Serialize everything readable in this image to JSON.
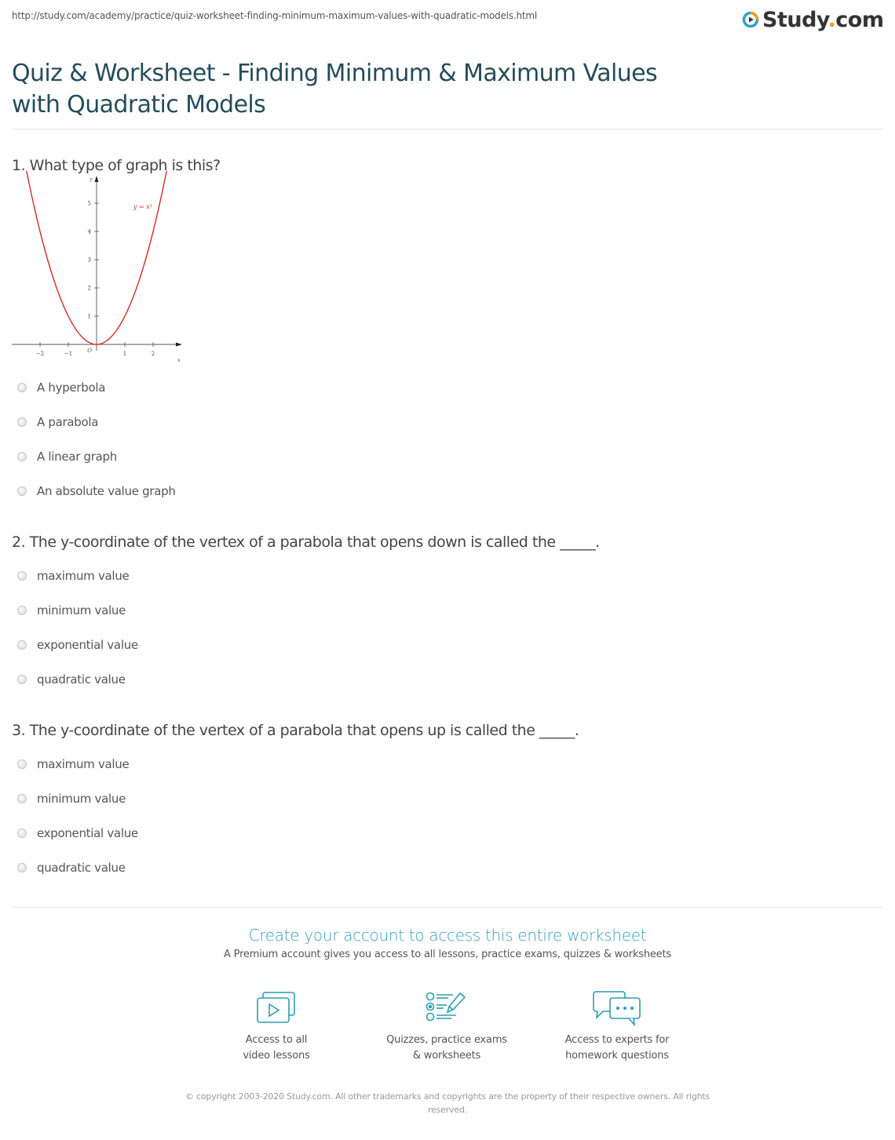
{
  "header": {
    "url": "http://study.com/academy/practice/quiz-worksheet-finding-minimum-maximum-values-with-quadratic-models.html",
    "logo_text_main": "Study",
    "logo_text_dot": ".",
    "logo_text_tld": "com",
    "logo_icon": "play-circle-icon"
  },
  "page": {
    "title": "Quiz & Worksheet - Finding Minimum & Maximum Values with Quadratic Models"
  },
  "questions": [
    {
      "text": "1. What type of graph is this?",
      "options": [
        "A hyperbola",
        "A parabola",
        "A linear graph",
        "An absolute value graph"
      ]
    },
    {
      "text": "2. The y-coordinate of the vertex of a parabola that opens down is called the _____.",
      "options": [
        "maximum value",
        "minimum value",
        "exponential value",
        "quadratic value"
      ]
    },
    {
      "text": "3. The y-coordinate of the vertex of a parabola that opens up is called the _____.",
      "options": [
        "maximum value",
        "minimum value",
        "exponential value",
        "quadratic value"
      ]
    }
  ],
  "chart_data": {
    "type": "line",
    "title": "",
    "series": [
      {
        "name": "y = x^2",
        "function": "x^2",
        "color": "#d42a2a"
      }
    ],
    "curve_label": "y = x²",
    "xlabel": "x",
    "ylabel": "y",
    "origin_label": "O",
    "x_ticks": [
      -2,
      -1,
      1,
      2
    ],
    "x_tick_labels": [
      "−2",
      "−1",
      "1",
      "2"
    ],
    "y_ticks": [
      1,
      2,
      3,
      4,
      5
    ],
    "y_tick_labels": [
      "1",
      "2",
      "3",
      "4",
      "5"
    ],
    "xlim": [
      -3,
      3
    ],
    "ylim": [
      0,
      6
    ],
    "grid": false
  },
  "cta": {
    "title": "Create your account to access this entire worksheet",
    "subtitle": "A Premium account gives you access to all lessons, practice exams, quizzes & worksheets",
    "features": [
      {
        "icon": "video-lessons-icon",
        "line1": "Access to all",
        "line2": "video lessons"
      },
      {
        "icon": "quiz-checklist-icon",
        "line1": "Quizzes, practice exams",
        "line2": "& worksheets"
      },
      {
        "icon": "chat-bubbles-icon",
        "line1": "Access to experts for",
        "line2": "homework questions"
      }
    ],
    "accent_color": "#2e9cb1"
  },
  "footer": {
    "copyright": "© copyright 2003-2020 Study.com. All other trademarks and copyrights are the property of their respective owners. All rights reserved."
  }
}
